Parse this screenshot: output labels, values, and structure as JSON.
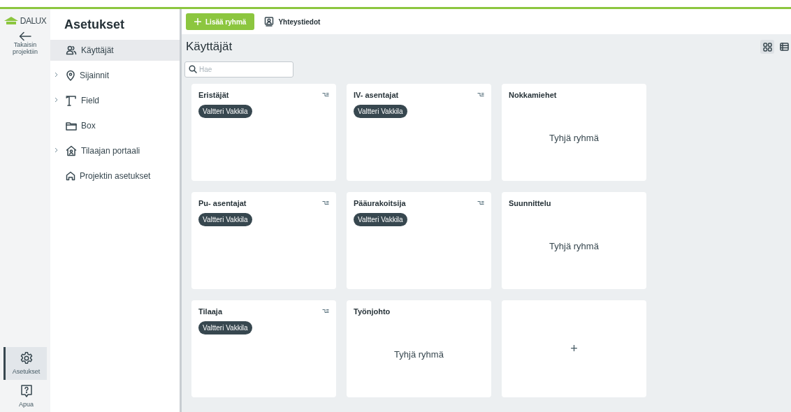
{
  "rail": {
    "logo": "DALUX",
    "back": "Takaisin projektiin",
    "bottom_items": [
      {
        "label": "Asetukset",
        "selected": true
      },
      {
        "label": "Apua",
        "selected": false
      }
    ]
  },
  "sidebar": {
    "title": "Asetukset",
    "items": [
      {
        "label": "Käyttäjät",
        "expandable": false,
        "selected": true
      },
      {
        "label": "Sijainnit",
        "expandable": true,
        "selected": false
      },
      {
        "label": "Field",
        "expandable": true,
        "selected": false
      },
      {
        "label": "Box",
        "expandable": false,
        "selected": false
      },
      {
        "label": "Tilaajan portaali",
        "expandable": true,
        "selected": false
      },
      {
        "label": "Projektin asetukset",
        "expandable": false,
        "selected": false
      }
    ]
  },
  "toolbar": {
    "add_button": "Lisää ryhmä",
    "contacts": "Yhteystiedot"
  },
  "page_title": "Käyttäjät",
  "search": {
    "placeholder": "Hae"
  },
  "view_toggle": [
    {
      "selected": true
    },
    {
      "selected": false
    }
  ],
  "groups": [
    {
      "kind": "members",
      "title": "Eristäjät",
      "members": [
        "Valtteri Vakkila"
      ]
    },
    {
      "kind": "members",
      "title": "IV- asentajat",
      "members": [
        "Valtteri Vakkila"
      ]
    },
    {
      "kind": "empty",
      "title": "Nokkamiehet",
      "empty_text": "Tyhjä ryhmä"
    },
    {
      "kind": "members",
      "title": "Pu- asentajat",
      "members": [
        "Valtteri Vakkila"
      ]
    },
    {
      "kind": "members",
      "title": "Pääurakoitsija",
      "members": [
        "Valtteri Vakkila"
      ]
    },
    {
      "kind": "empty",
      "title": "Suunnittelu",
      "empty_text": "Tyhjä ryhmä"
    },
    {
      "kind": "members",
      "title": "Tilaaja",
      "members": [
        "Valtteri Vakkila"
      ]
    },
    {
      "kind": "empty",
      "title": "Työnjohto",
      "empty_text": "Tyhjä ryhmä"
    },
    {
      "kind": "add",
      "label": "+"
    }
  ]
}
